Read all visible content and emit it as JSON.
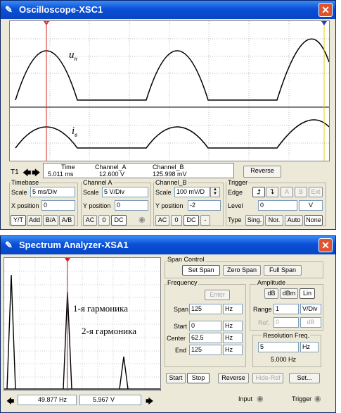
{
  "oscilloscope": {
    "title": "Oscilloscope-XSC1",
    "labels": {
      "un": "u",
      "un_sub": "н",
      "ig": "i",
      "ig_sub": "в"
    },
    "readout": {
      "t1": "T1",
      "time_header": "Time",
      "cha_header": "Channel_A",
      "chb_header": "Channel_B",
      "time_value": "5.011 ms",
      "cha_value": "12.600 V",
      "chb_value": "125.998 mV",
      "reverse": "Reverse"
    },
    "timebase": {
      "title": "Timebase",
      "scale_label": "Scale",
      "scale": "5 ms/Div",
      "xpos_label": "X position",
      "xpos": "0",
      "buttons": [
        "Y/T",
        "Add",
        "B/A",
        "A/B"
      ]
    },
    "channel_a": {
      "title": "Channel A",
      "scale_label": "Scale",
      "scale": "5  V/Div",
      "ypos_label": "Y position",
      "ypos": "0",
      "buttons": [
        "AC",
        "0",
        "DC"
      ]
    },
    "channel_b": {
      "title": "Channel_B",
      "scale_label": "Scale",
      "scale": "100 mV/D",
      "ypos_label": "Y position",
      "ypos": "-2",
      "buttons": [
        "AC",
        "0",
        "DC",
        "-"
      ]
    },
    "trigger": {
      "title": "Trigger",
      "edge_label": "Edge",
      "level_label": "Level",
      "level": "0",
      "level_unit": "V",
      "source_buttons": [
        "A",
        "B",
        "Ext"
      ],
      "type_label": "Type",
      "type_buttons": [
        "Sing.",
        "Nor.",
        "Auto",
        "None"
      ]
    }
  },
  "spectrum": {
    "title": "Spectrum Analyzer-XSA1",
    "annotations": {
      "h1": "1-я гармоника",
      "h2": "2-я гармоника"
    },
    "span_control": {
      "title": "Span Control",
      "buttons": [
        "Set Span",
        "Zero Span",
        "Full Span"
      ]
    },
    "frequency": {
      "title": "Frequency",
      "enter": "Enter",
      "span_label": "Span",
      "span": "125",
      "span_unit": "Hz",
      "start_label": "Start",
      "start": "0",
      "start_unit": "Hz",
      "center_label": "Center",
      "center": "62.5",
      "center_unit": "Hz",
      "end_label": "End",
      "end": "125",
      "end_unit": "Hz"
    },
    "amplitude": {
      "title": "Amplitude",
      "buttons": [
        "dB",
        "dBm",
        "Lin"
      ],
      "range_label": "Range",
      "range": "1",
      "range_unit": "V/Div",
      "ref_label": "Ref.",
      "ref": "0",
      "ref_unit": "dB"
    },
    "resolution": {
      "title": "Resolution Freq.",
      "value": "5",
      "unit": "Hz",
      "readout": "5.000  Hz"
    },
    "bottom_buttons": [
      "Start",
      "Stop",
      "Reverse",
      "Hide-Ref",
      "Set..."
    ],
    "input_label": "Input",
    "trigger_label": "Trigger",
    "freq_readout": "49.877  Hz",
    "amp_readout": "5.967  V"
  },
  "colors": {
    "titlebar": "#0a4fd6",
    "close": "#e0532f",
    "cursor1": "#d42020",
    "cursor2": "#e8d000"
  }
}
